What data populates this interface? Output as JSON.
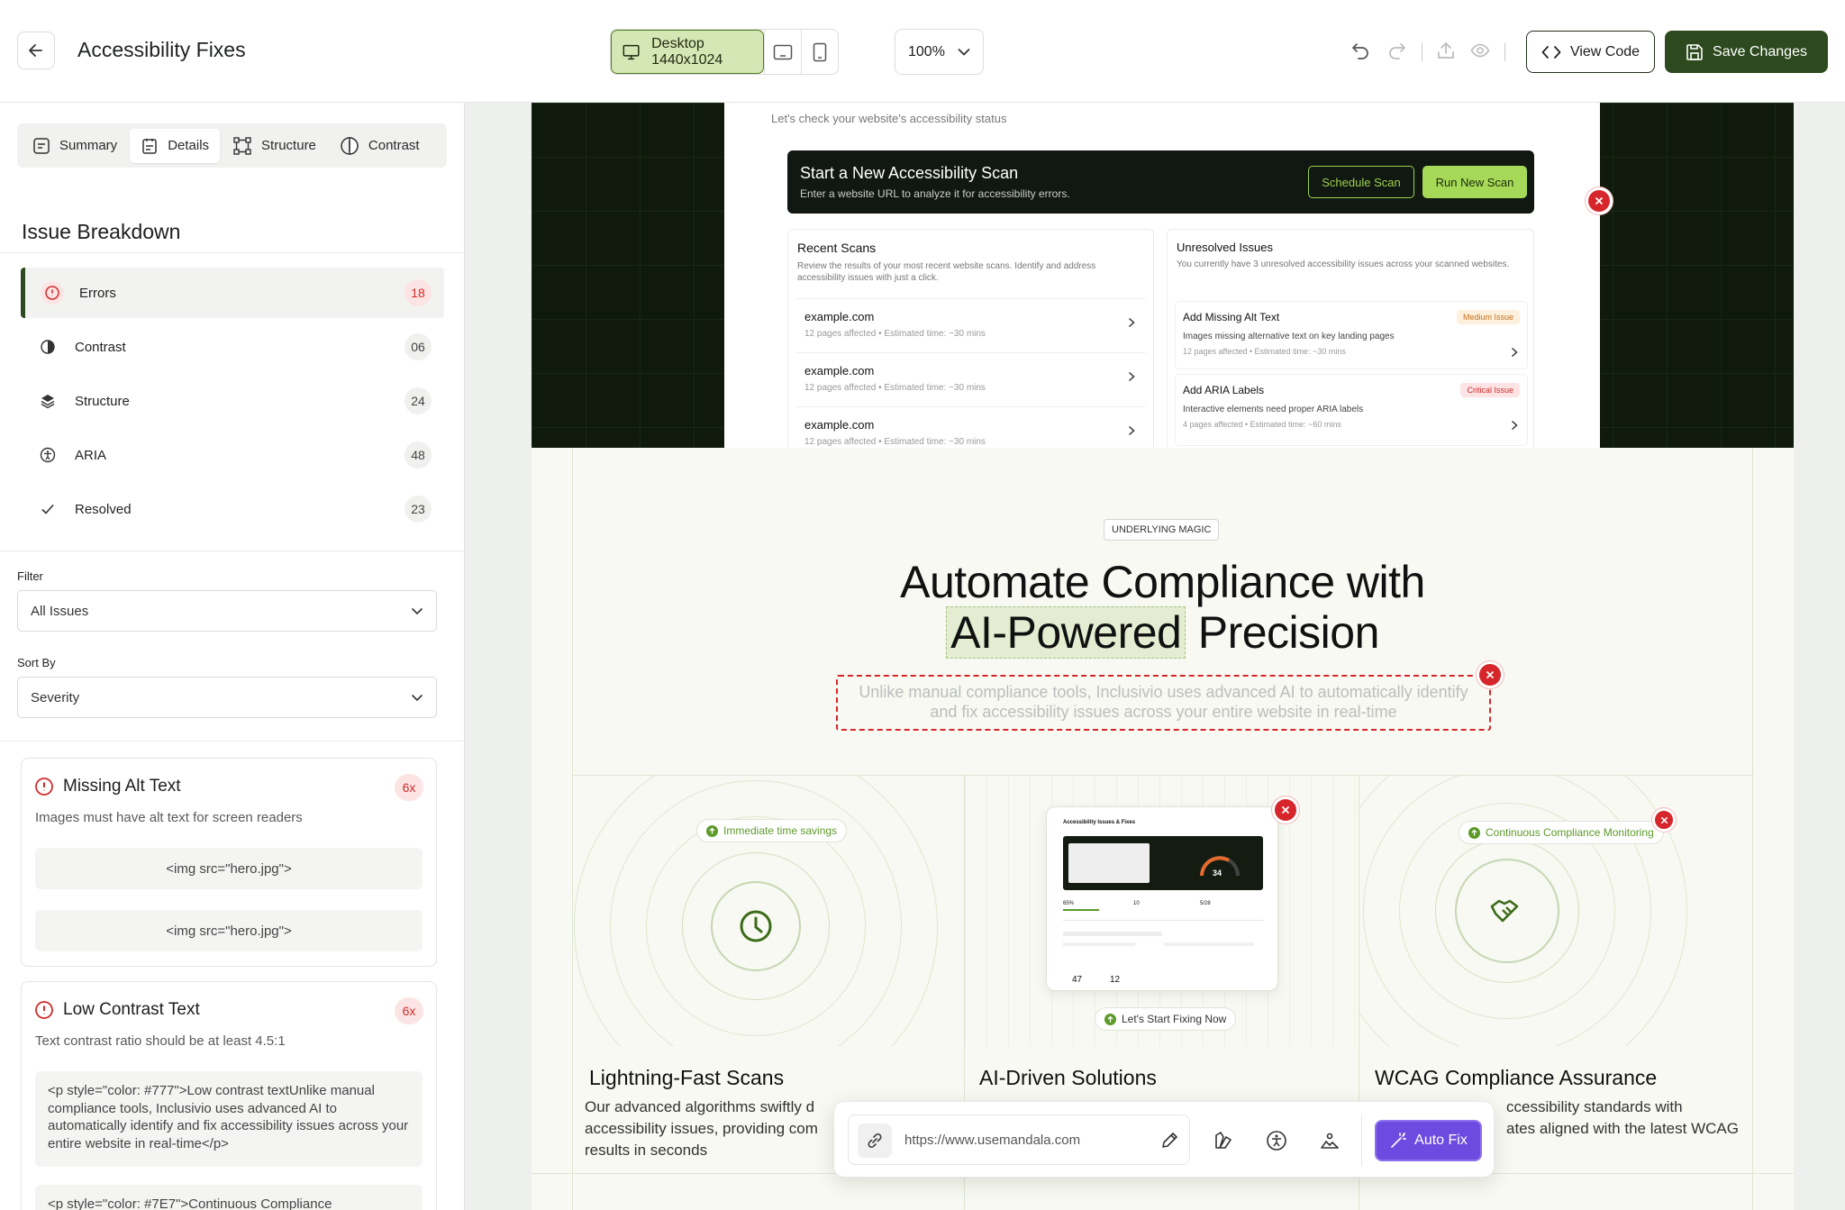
{
  "header": {
    "title": "Accessibility Fixes",
    "device_label": "Desktop 1440x1024",
    "zoom": "100%",
    "view_code": "View Code",
    "save_changes": "Save Changes"
  },
  "sidebar": {
    "tabs": [
      "Summary",
      "Details",
      "Structure",
      "Contrast"
    ],
    "active_tab": "Details",
    "breakdown_title": "Issue Breakdown",
    "issues": [
      {
        "label": "Errors",
        "count": "18"
      },
      {
        "label": "Contrast",
        "count": "06"
      },
      {
        "label": "Structure",
        "count": "24"
      },
      {
        "label": "ARIA",
        "count": "48"
      },
      {
        "label": "Resolved",
        "count": "23"
      }
    ],
    "filter_label": "Filter",
    "filter_value": "All Issues",
    "sort_label": "Sort By",
    "sort_value": "Severity",
    "cards": [
      {
        "title": "Missing Alt Text",
        "count": "6x",
        "desc": "Images must have alt text for screen readers",
        "code": [
          "<img src=\"hero.jpg\">",
          "<img src=\"hero.jpg\">"
        ]
      },
      {
        "title": "Low Contrast Text",
        "count": "6x",
        "desc": "Text contrast ratio should be at least 4.5:1",
        "code": [
          "<p style=\"color: #777\">Low contrast textUnlike manual compliance tools, Inclusivio uses advanced AI to automatically identify and fix accessibility issues across your entire website in real-time</p>",
          "<p style=\"color: #7E7\">Continuous Compliance"
        ]
      }
    ]
  },
  "preview": {
    "hero": {
      "top_text": "Let's check your website's accessibility status",
      "scan_title": "Start a New Accessibility Scan",
      "scan_sub": "Enter a website URL to analyze it for accessibility errors.",
      "schedule_scan": "Schedule Scan",
      "run_scan": "Run New Scan",
      "recent_title": "Recent Scans",
      "recent_desc": "Review the results of your most recent website scans. Identify and address accessibility issues with just a click.",
      "recent_items": [
        {
          "domain": "example.com",
          "meta": "12 pages affected  • Estimated time: ~30 mins"
        },
        {
          "domain": "example.com",
          "meta": "12 pages affected  • Estimated time: ~30 mins"
        },
        {
          "domain": "example.com",
          "meta": "12 pages affected  • Estimated time: ~30 mins"
        }
      ],
      "unresolved_title": "Unresolved Issues",
      "unresolved_desc": "You currently have 3 unresolved accessibility issues across your scanned websites.",
      "unresolved_items": [
        {
          "title": "Add Missing Alt Text",
          "badge": "Medium Issue",
          "desc": "Images missing alternative text on key landing pages",
          "meta": "12 pages affected  • Estimated time: ~30 mins"
        },
        {
          "title": "Add ARIA Labels",
          "badge": "Critical Issue",
          "desc": "Interactive elements need proper ARIA labels",
          "meta": "4 pages affected  • Estimated time: ~60 mins"
        }
      ]
    },
    "section": {
      "tag": "UNDERLYING MAGIC",
      "heading_line1": "Automate Compliance with",
      "heading_highlight": "AI-Powered",
      "heading_rest": "Precision",
      "subtext": "Unlike manual compliance tools, Inclusivio uses advanced AI to automatically identify and fix accessibility issues across your entire website in real-time"
    },
    "features": [
      {
        "chip": "Immediate time savings",
        "title": "Lightning-Fast Scans",
        "desc": "Our advanced algorithms swiftly d... accessibility issues, providing com... results in seconds"
      },
      {
        "chip": "Let's Start Fixing Now",
        "title": "AI-Driven Solutions",
        "desc": ""
      },
      {
        "chip": "Continuous Compliance Monitoring",
        "title": "WCAG Compliance Assurance",
        "desc": "...ccessibility standards with ...ates aligned with the latest WCAG"
      }
    ],
    "feature_desc_lines": {
      "f1": [
        "Our advanced algorithms swiftly d",
        "accessibility issues, providing com",
        "results in seconds"
      ],
      "f3": [
        "ccessibility standards with",
        "ates aligned with the latest WCAG"
      ]
    },
    "mini_card": {
      "title": "Accessibility Issues & Fixes",
      "score": "34",
      "stats": [
        "65%",
        "10",
        "5/28"
      ],
      "bottom": [
        "47",
        "12"
      ]
    }
  },
  "toolbar": {
    "url": "https://www.usemandala.com",
    "auto_fix": "Auto Fix"
  },
  "colors": {
    "brand_dark": "#2c4a1d",
    "accent_green": "#c3ec7a",
    "error_red": "#d7262b",
    "autofix_purple": "#6d4be0"
  }
}
